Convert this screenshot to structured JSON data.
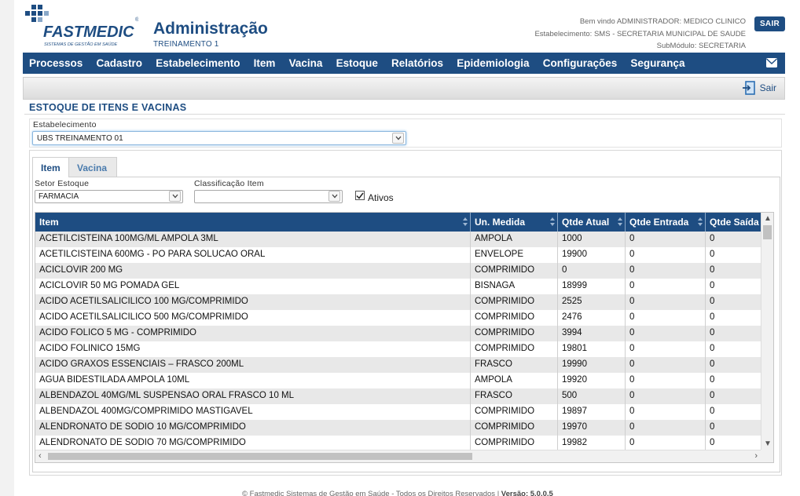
{
  "brand": {
    "name": "FASTMEDIC",
    "tagline": "SISTEMAS DE GESTÃO EM SAÚDE",
    "registered": "®"
  },
  "header": {
    "title": "Administração",
    "subtitle": "TREINAMENTO 1",
    "welcome": "Bem vindo ADMINISTRADOR: MEDICO CLINICO",
    "establishment": "Estabelecimento: SMS - SECRETARIA MUNICIPAL DE SAUDE",
    "submodule": "SubMódulo: SECRETARIA",
    "logout_label": "SAIR"
  },
  "menu": [
    "Processos",
    "Cadastro",
    "Estabelecimento",
    "Item",
    "Vacina",
    "Estoque",
    "Relatórios",
    "Epidemiologia",
    "Configurações",
    "Segurança"
  ],
  "toolbar": {
    "exit_label": "Sair"
  },
  "section": {
    "title": "ESTOQUE DE ITENS E VACINAS",
    "establishment_label": "Estabelecimento",
    "establishment_value": "UBS TREINAMENTO 01"
  },
  "tabs": [
    {
      "label": "Item",
      "active": true
    },
    {
      "label": "Vacina",
      "active": false
    }
  ],
  "filters": {
    "sector_label": "Setor Estoque",
    "sector_value": "FARMACIA",
    "classification_label": "Classificação Item",
    "classification_value": "",
    "active_label": "Ativos",
    "active_checked": true
  },
  "grid": {
    "columns": [
      "Item",
      "Un. Medida",
      "Qtde Atual",
      "Qtde Entrada",
      "Qtde Saída"
    ],
    "rows": [
      [
        "ACETILCISTEINA 100MG/ML AMPOLA 3ML",
        "AMPOLA",
        "1000",
        "0",
        "0"
      ],
      [
        "ACETILCISTEINA 600MG - PO PARA SOLUCAO ORAL",
        "ENVELOPE",
        "19900",
        "0",
        "0"
      ],
      [
        "ACICLOVIR 200 MG",
        "COMPRIMIDO",
        "0",
        "0",
        "0"
      ],
      [
        "ACICLOVIR 50 MG POMADA GEL",
        "BISNAGA",
        "18999",
        "0",
        "0"
      ],
      [
        "ACIDO ACETILSALICILICO 100 MG/COMPRIMIDO",
        "COMPRIMIDO",
        "2525",
        "0",
        "0"
      ],
      [
        "ACIDO ACETILSALICILICO 500 MG/COMPRIMIDO",
        "COMPRIMIDO",
        "2476",
        "0",
        "0"
      ],
      [
        "ACIDO FOLICO 5 MG - COMPRIMIDO",
        "COMPRIMIDO",
        "3994",
        "0",
        "0"
      ],
      [
        "ACIDO FOLINICO 15MG",
        "COMPRIMIDO",
        "19801",
        "0",
        "0"
      ],
      [
        "ACIDO GRAXOS ESSENCIAIS – FRASCO 200ML",
        "FRASCO",
        "19990",
        "0",
        "0"
      ],
      [
        "AGUA BIDESTILADA AMPOLA 10ML",
        "AMPOLA",
        "19920",
        "0",
        "0"
      ],
      [
        "ALBENDAZOL 40MG/ML SUSPENSAO ORAL FRASCO 10 ML",
        "FRASCO",
        "500",
        "0",
        "0"
      ],
      [
        "ALBENDAZOL 400MG/COMPRIMIDO MASTIGAVEL",
        "COMPRIMIDO",
        "19897",
        "0",
        "0"
      ],
      [
        "ALENDRONATO DE SODIO 10 MG/COMPRIMIDO",
        "COMPRIMIDO",
        "19970",
        "0",
        "0"
      ],
      [
        "ALENDRONATO DE SODIO 70 MG/COMPRIMIDO",
        "COMPRIMIDO",
        "19982",
        "0",
        "0"
      ]
    ]
  },
  "footer": {
    "text": "© Fastmedic Sistemas de Gestão em Saúde - Todos os Direitos Reservados |",
    "version_label": "Versão: 5.0.0.5"
  },
  "colors": {
    "primary": "#1e4d82",
    "row_alt": "#e8e8e8"
  },
  "icons": {
    "mail": "envelope-icon",
    "exit": "exit-door-icon",
    "dropdown": "chevron-down-icon",
    "sort": "sort-icon"
  }
}
